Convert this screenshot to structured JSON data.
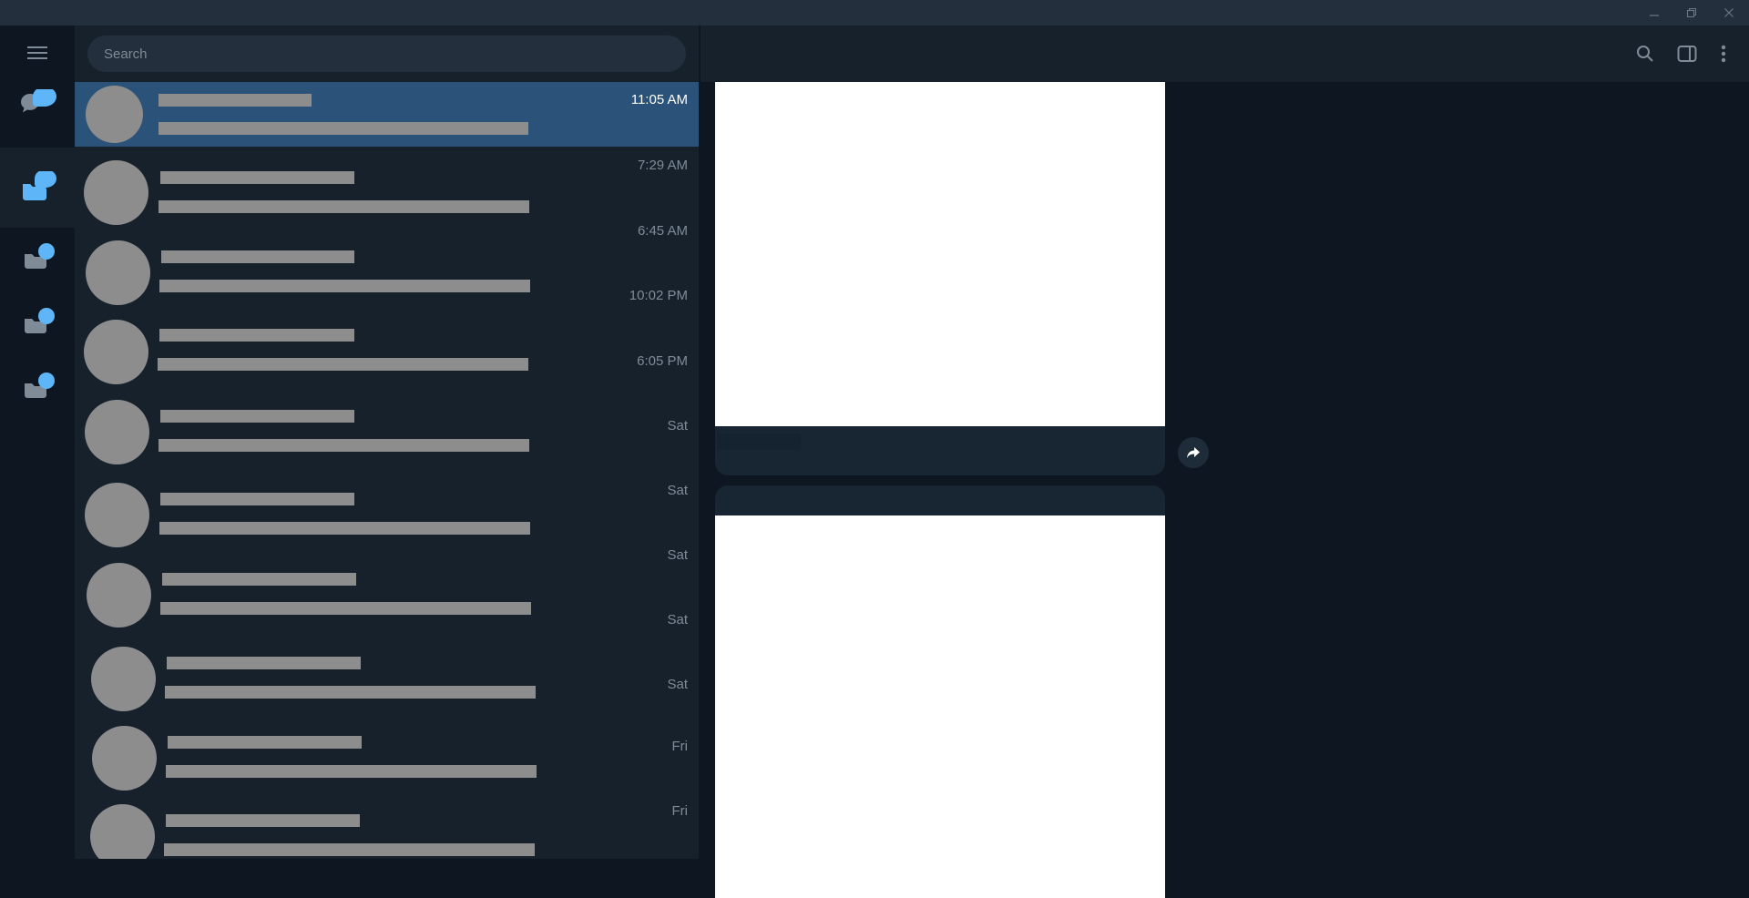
{
  "search": {
    "placeholder": "Search"
  },
  "colors": {
    "titlebar": "#242f3d",
    "sidebar_bg": "#17212b",
    "selected_row": "#2b5278",
    "chat_bg": "#0e1621",
    "accent_blue": "#5eb5f7",
    "redacted_gray": "#8d8d8d"
  },
  "window_controls": [
    "minimize-icon",
    "restore-icon",
    "close-icon"
  ],
  "folders": [
    {
      "icon": "all-chats-icon"
    },
    {
      "icon": "folder-chats-icon",
      "active": true
    },
    {
      "icon": "folder-chats-icon"
    },
    {
      "icon": "folder-chats-icon"
    },
    {
      "icon": "folder-chats-icon"
    }
  ],
  "chats": [
    {
      "time": "11:05 AM",
      "selected": true
    },
    {
      "time": "7:29 AM"
    },
    {
      "time": "6:45 AM"
    },
    {
      "time": "10:02 PM"
    },
    {
      "time": "6:05 PM"
    },
    {
      "time": "Sat"
    },
    {
      "time": "Sat"
    },
    {
      "time": "Sat"
    },
    {
      "time": "Sat"
    },
    {
      "time": "Sat"
    },
    {
      "time": "Fri"
    },
    {
      "time": "Fri"
    }
  ],
  "chat_header": {
    "icons": [
      "search-icon",
      "sidebar-toggle-icon",
      "more-vertical-icon"
    ]
  },
  "messages": [
    {
      "type": "photo",
      "forward_icon": "share-arrow-icon"
    },
    {
      "type": "photo"
    }
  ]
}
